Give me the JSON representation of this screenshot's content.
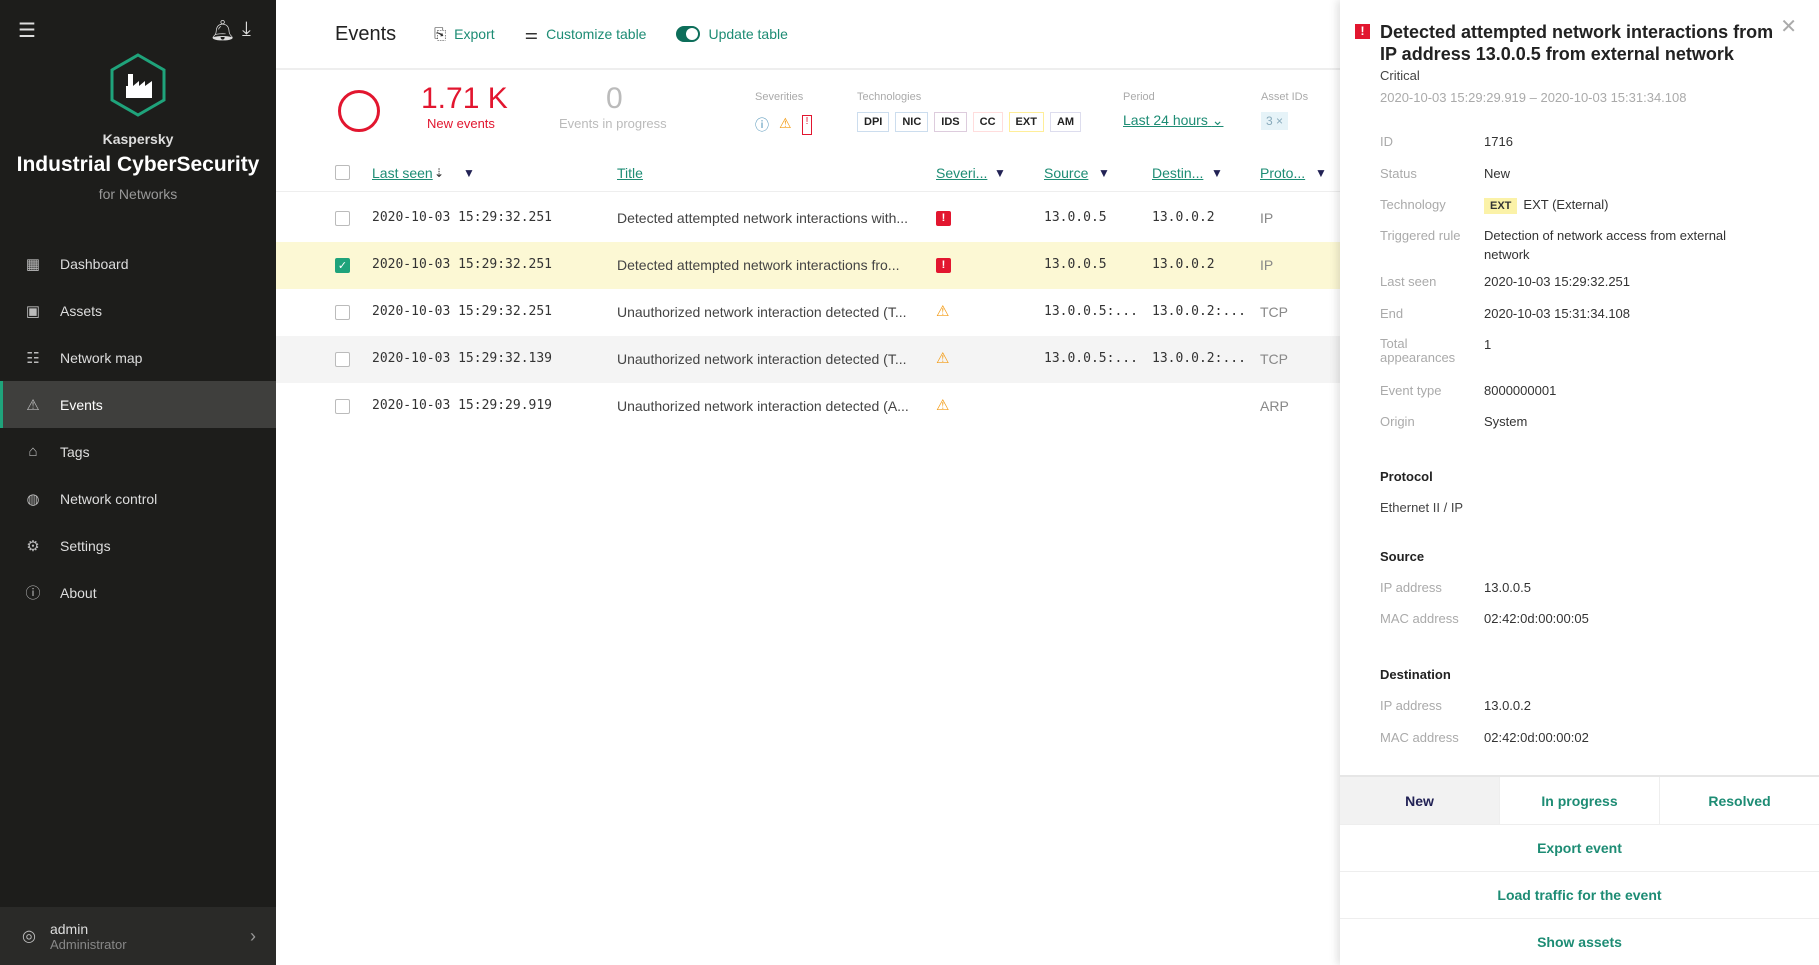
{
  "sidebar": {
    "brand_company": "Kaspersky",
    "brand_product": "Industrial CyberSecurity",
    "brand_sub": "for Networks",
    "items": [
      {
        "label": "Dashboard",
        "icon": "dashboard-icon"
      },
      {
        "label": "Assets",
        "icon": "assets-icon"
      },
      {
        "label": "Network map",
        "icon": "network-map-icon"
      },
      {
        "label": "Events",
        "icon": "warning-icon",
        "active": true
      },
      {
        "label": "Tags",
        "icon": "tag-icon"
      },
      {
        "label": "Network control",
        "icon": "globe-icon"
      },
      {
        "label": "Settings",
        "icon": "gear-icon"
      },
      {
        "label": "About",
        "icon": "info-icon"
      }
    ],
    "user": {
      "name": "admin",
      "role": "Administrator"
    }
  },
  "toolbar": {
    "title": "Events",
    "export": "Export",
    "customize": "Customize table",
    "update": "Update table"
  },
  "stats": {
    "new_count": "1.71 K",
    "new_label": "New events",
    "progress_count": "0",
    "progress_label": "Events in progress",
    "severities_label": "Severities",
    "technologies_label": "Technologies",
    "technologies": [
      "DPI",
      "NIC",
      "IDS",
      "CC",
      "EXT",
      "AM"
    ],
    "period_label": "Period",
    "period_value": "Last 24 hours",
    "asset_ids_label": "Asset IDs",
    "asset_ids_value": "3 ×"
  },
  "table": {
    "columns": [
      "Last seen",
      "Title",
      "Severi...",
      "Source",
      "Destin...",
      "Proto..."
    ],
    "rows": [
      {
        "last_seen": "2020-10-03 15:29:32.251",
        "title": "Detected attempted network interactions with...",
        "severity": "critical",
        "source": "13.0.0.5",
        "dest": "13.0.0.2",
        "proto": "IP"
      },
      {
        "last_seen": "2020-10-03 15:29:32.251",
        "title": "Detected attempted network interactions fro...",
        "severity": "critical",
        "source": "13.0.0.5",
        "dest": "13.0.0.2",
        "proto": "IP",
        "selected": true
      },
      {
        "last_seen": "2020-10-03 15:29:32.251",
        "title": "Unauthorized network interaction detected (T...",
        "severity": "warning",
        "source": "13.0.0.5:...",
        "dest": "13.0.0.2:...",
        "proto": "TCP"
      },
      {
        "last_seen": "2020-10-03 15:29:32.139",
        "title": "Unauthorized network interaction detected (T...",
        "severity": "warning",
        "source": "13.0.0.5:...",
        "dest": "13.0.0.2:...",
        "proto": "TCP"
      },
      {
        "last_seen": "2020-10-03 15:29:29.919",
        "title": "Unauthorized network interaction detected (A...",
        "severity": "warning",
        "source": "",
        "dest": "",
        "proto": "ARP"
      }
    ]
  },
  "panel": {
    "title": "Detected attempted network interactions from IP address 13.0.0.5 from external network",
    "severity": "Critical",
    "time_range": "2020-10-03 15:29:29.919 – 2020-10-03 15:31:34.108",
    "fields": {
      "id_l": "ID",
      "id": "1716",
      "status_l": "Status",
      "status": "New",
      "tech_l": "Technology",
      "tech_badge": "EXT",
      "tech": "EXT (External)",
      "rule_l": "Triggered rule",
      "rule": "Detection of network access from external network",
      "last_l": "Last seen",
      "last": "2020-10-03 15:29:32.251",
      "end_l": "End",
      "end": "2020-10-03 15:31:34.108",
      "total_l": "Total appearances",
      "total": "1",
      "type_l": "Event type",
      "type": "8000000001",
      "origin_l": "Origin",
      "origin": "System"
    },
    "protocol_h": "Protocol",
    "protocol": "Ethernet II / IP",
    "source_h": "Source",
    "src_ip_l": "IP address",
    "src_ip": "13.0.0.5",
    "src_mac_l": "MAC address",
    "src_mac": "02:42:0d:00:00:05",
    "dest_h": "Destination",
    "dst_ip_l": "IP address",
    "dst_ip": "13.0.0.2",
    "dst_mac_l": "MAC address",
    "dst_mac": "02:42:0d:00:00:02",
    "status_tabs": [
      "New",
      "In progress",
      "Resolved"
    ],
    "export": "Export event",
    "load": "Load traffic for the event",
    "show_assets": "Show assets"
  },
  "colors": {
    "accent": "#1d8c74",
    "critical": "#e2162f",
    "warning": "#f39a12",
    "selected_row": "#fcf8d4",
    "sidebar": "#1d1d1b"
  }
}
